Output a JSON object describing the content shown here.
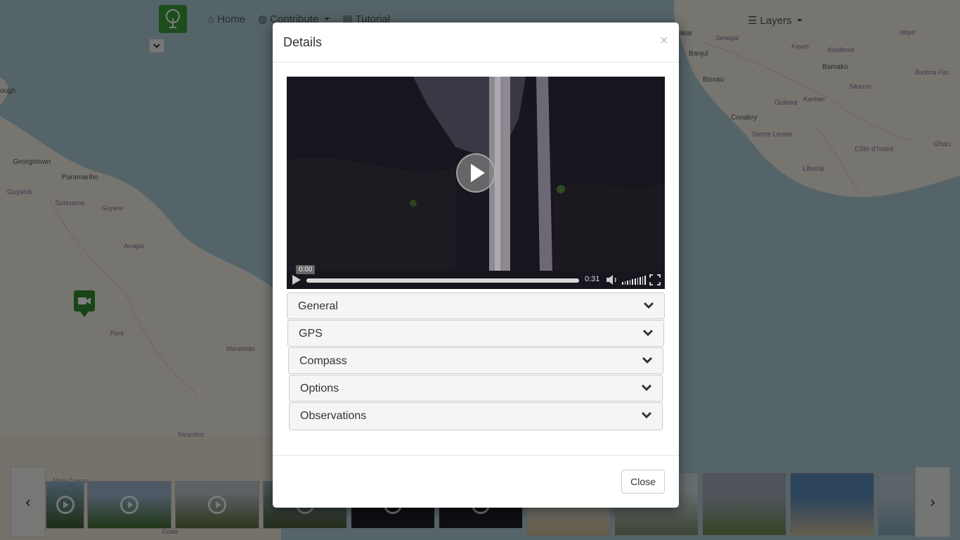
{
  "nav": {
    "home_label": "Home",
    "contribute_label": "Contribute",
    "tutorial_label": "Tutorial",
    "layers_label": "Layers"
  },
  "map": {
    "labels": [
      "Georgetown",
      "Paramaribo",
      "Guyana",
      "Suriname",
      "Guyane",
      "Amapá",
      "Pará",
      "Maranhão",
      "Tocantins",
      "Mato Grosso",
      "Goiás",
      "ough",
      "Senegal",
      "Banjul",
      "Bissau",
      "Bamako",
      "Kayes",
      "Koulikoro",
      "Mopti",
      "Burkina Fas",
      "Sikasso",
      "Guinea",
      "Kankan",
      "Conakry",
      "Sierra Leone",
      "Côte d'Ivoire",
      "Ghan",
      "Liberia",
      "akar"
    ]
  },
  "modal": {
    "title": "Details",
    "close_symbol": "×",
    "video": {
      "current_time": "0:00",
      "duration": "0:31",
      "progress": 0.0
    },
    "accordion": [
      {
        "label": "General"
      },
      {
        "label": "GPS"
      },
      {
        "label": "Compass"
      },
      {
        "label": "Options"
      },
      {
        "label": "Observations"
      }
    ],
    "footer_close_label": "Close"
  },
  "colors": {
    "brand_green": "#3b9a3b",
    "marker_green": "#2e8b2e",
    "backdrop": "rgba(0,0,0,0.5)"
  }
}
